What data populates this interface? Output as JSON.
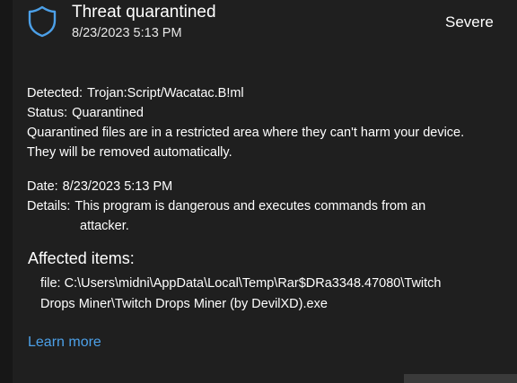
{
  "header": {
    "title": "Threat quarantined",
    "timestamp": "8/23/2023 5:13 PM",
    "severity": "Severe",
    "icon": "shield-icon"
  },
  "detection": {
    "detected_label": "Detected:",
    "detected_value": "Trojan:Script/Wacatac.B!ml",
    "status_label": "Status:",
    "status_value": "Quarantined",
    "note_line1": "Quarantined files are in a restricted area where they can't harm your device.",
    "note_line2": "They will be removed automatically."
  },
  "info": {
    "date_label": "Date:",
    "date_value": "8/23/2023 5:13 PM",
    "details_label": "Details:",
    "details_line1": "This program is dangerous and executes commands from an",
    "details_line2": "attacker."
  },
  "affected": {
    "heading": "Affected items:",
    "path_line1": "file: C:\\Users\\midni\\AppData\\Local\\Temp\\Rar$DRa3348.47080\\Twitch",
    "path_line2": "Drops Miner\\Twitch Drops Miner (by DevilXD).exe"
  },
  "learn_more": "Learn more",
  "colors": {
    "background": "#1f1f1f",
    "icon_accent": "#4ca0e8",
    "link": "#4ca0e8"
  }
}
